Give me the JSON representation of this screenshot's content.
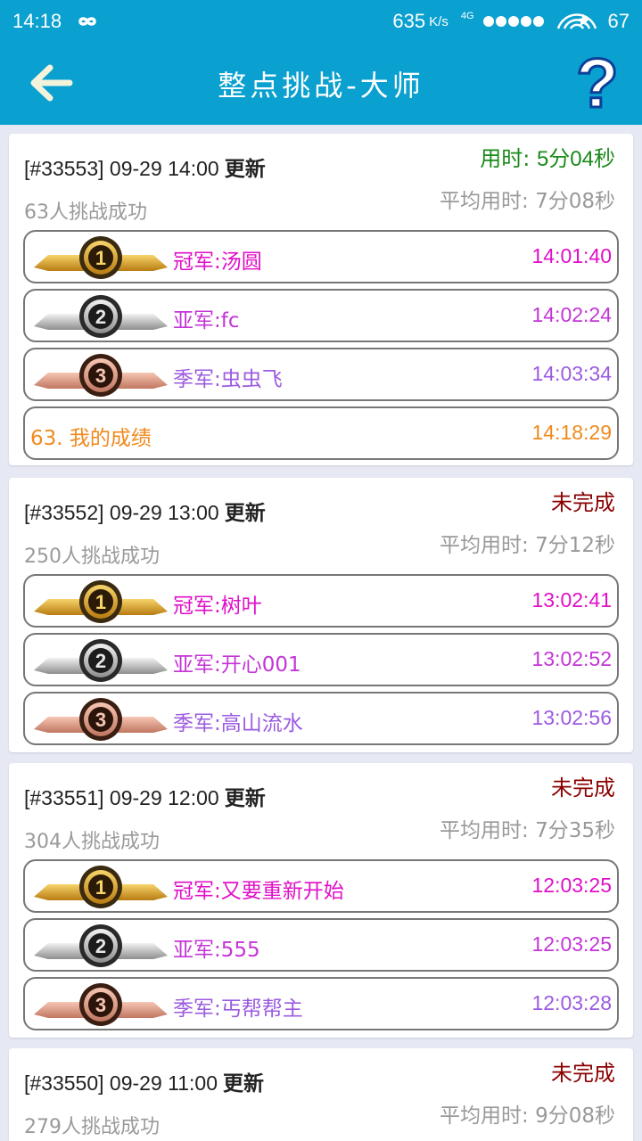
{
  "status_bar": {
    "time": "14:18",
    "speed": "635",
    "speed_unit": "K/s",
    "network": "4G",
    "battery": "67"
  },
  "header": {
    "title": "整点挑战-大师"
  },
  "colors": {
    "brand": "#0aa0cf",
    "gold": "#e00fc8",
    "silver": "#c335d6",
    "bronze": "#9b5be0",
    "mine": "#f08a1e",
    "used_time": "#1a8a1a",
    "unfinished": "#8b0000"
  },
  "cards": [
    {
      "id_time": "[#33553] 09-29 14:00",
      "update_label": "更新",
      "status_label": "用时:",
      "status_value": "5分04秒",
      "avg_label": "平均用时:",
      "avg_value": "7分08秒",
      "count": "63人挑战成功",
      "ranks": [
        {
          "medal": "1",
          "name": "冠军:汤圆",
          "time": "14:01:40"
        },
        {
          "medal": "2",
          "name": "亚军:fc",
          "time": "14:02:24"
        },
        {
          "medal": "3",
          "name": "季军:虫虫飞",
          "time": "14:03:34"
        }
      ],
      "mine": {
        "name": "63. 我的成绩",
        "time": "14:18:29"
      }
    },
    {
      "id_time": "[#33552] 09-29 13:00",
      "update_label": "更新",
      "status_label": "未完成",
      "avg_label": "平均用时:",
      "avg_value": "7分12秒",
      "count": "250人挑战成功",
      "ranks": [
        {
          "medal": "1",
          "name": "冠军:树叶",
          "time": "13:02:41"
        },
        {
          "medal": "2",
          "name": "亚军:开心001",
          "time": "13:02:52"
        },
        {
          "medal": "3",
          "name": "季军:高山流水",
          "time": "13:02:56"
        }
      ]
    },
    {
      "id_time": "[#33551] 09-29 12:00",
      "update_label": "更新",
      "status_label": "未完成",
      "avg_label": "平均用时:",
      "avg_value": "7分35秒",
      "count": "304人挑战成功",
      "ranks": [
        {
          "medal": "1",
          "name": "冠军:又要重新开始",
          "time": "12:03:25"
        },
        {
          "medal": "2",
          "name": "亚军:555",
          "time": "12:03:25"
        },
        {
          "medal": "3",
          "name": "季军:丐帮帮主",
          "time": "12:03:28"
        }
      ]
    },
    {
      "id_time": "[#33550] 09-29 11:00",
      "update_label": "更新",
      "status_label": "未完成",
      "avg_label": "平均用时:",
      "avg_value": "9分08秒",
      "count": "279人挑战成功"
    }
  ]
}
